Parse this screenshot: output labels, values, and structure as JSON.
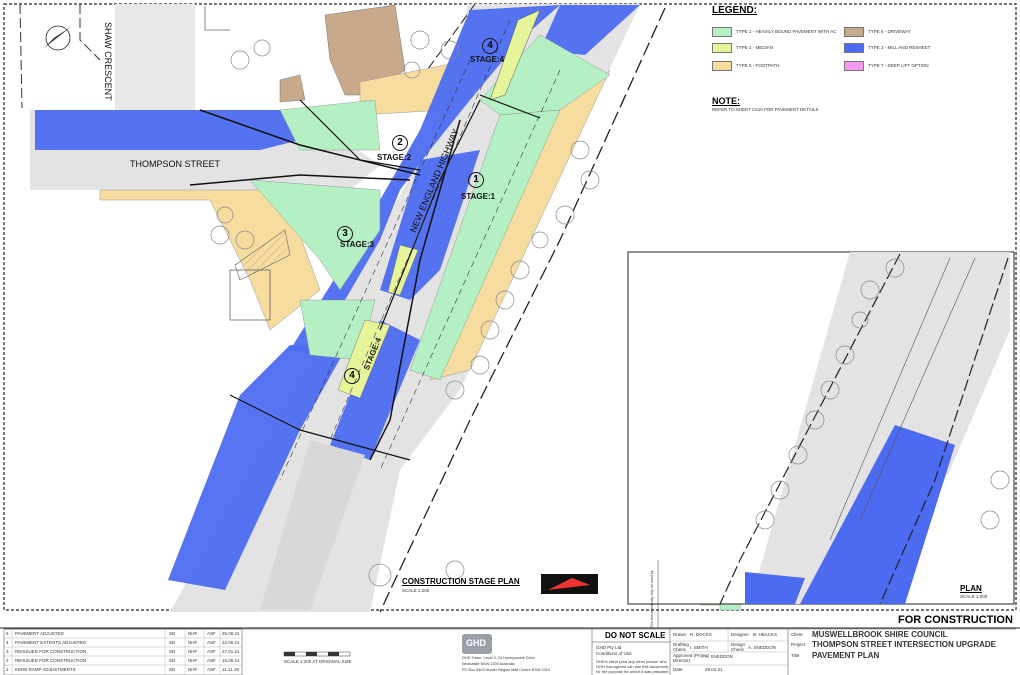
{
  "legend": {
    "title": "LEGEND:",
    "items": [
      {
        "label": "TYPE 1 - HEAVILY BOUND PAVEMENT WITH AC",
        "color": "#b5efc4"
      },
      {
        "label": "TYPE 6 - DRIVEWAY",
        "color": "#c9a98c"
      },
      {
        "label": "TYPE 4 - MEDIAN",
        "color": "#e6f59a"
      },
      {
        "label": "TYPE 2 - MILL AND RESHEET",
        "color": "#4d6bf0"
      },
      {
        "label": "TYPE 5 - FOOTPATH",
        "color": "#f7dca0"
      },
      {
        "label": "TYPE 7 - DEEP LIFT OPTION",
        "color": "#f29af0"
      }
    ]
  },
  "note": {
    "title": "NOTE:",
    "text": "REFER TO SHEET C510 FOR PAVEMENT DETAILS"
  },
  "streets": {
    "shaw_crescent": "SHAW CRESCENT",
    "thompson_street": "THOMPSON STREET",
    "new_england_highway": "NEW ENGLAND HIGHWAY"
  },
  "stages": {
    "stage1": {
      "num": "1",
      "label": "STAGE:1"
    },
    "stage2": {
      "num": "2",
      "label": "STAGE:2"
    },
    "stage3": {
      "num": "3",
      "label": "STAGE:3"
    },
    "stage4a": {
      "num": "4",
      "label": "STAGE:4"
    },
    "stage4b": {
      "num": "4",
      "label": "STAGE:4"
    }
  },
  "plan_titles": {
    "construction_stage_plan": "CONSTRUCTION STAGE PLAN",
    "construction_scale": "SCALE 1:200",
    "plan": "PLAN",
    "plan_scale": "SCALE 1:200"
  },
  "for_construction": "FOR CONSTRUCTION",
  "revisions": [
    {
      "rev": "5",
      "desc": "PAVEMENT ADJUSTED",
      "by": "SD",
      "chk": "NHF",
      "app": "ASF",
      "date": "25.06.21"
    },
    {
      "rev": "4",
      "desc": "PAVEMENT EXTENTS ADJUSTED",
      "by": "SD",
      "chk": "NHF",
      "app": "ASF",
      "date": "22.06.21"
    },
    {
      "rev": "3",
      "desc": "REISSUED FOR CONSTRUCTION",
      "by": "SD",
      "chk": "NHF",
      "app": "ASF",
      "date": "27.01.21"
    },
    {
      "rev": "2",
      "desc": "REISSUED FOR CONSTRUCTION",
      "by": "SD",
      "chk": "NHF",
      "app": "ASF",
      "date": "15.05.21"
    },
    {
      "rev": "1",
      "desc": "KERB RAMP ADJUSTMENTS",
      "by": "SD",
      "chk": "NHF",
      "app": "ASF",
      "date": "11.11.19"
    }
  ],
  "scale_bar": "SCALE 1:200 AT ORIGINAL SIZE",
  "ghd": {
    "logo": "GHD",
    "address1": "GHD Tower, Level 3, 24 Honeysuckle Drive",
    "address2": "Newcastle NSW 2300 Australia",
    "address3": "PO Box 5403 Hunter Region Mail Centre NSW 2310"
  },
  "do_not_scale": "DO NOT SCALE",
  "conditions": {
    "title": "GHD Pty Ltd",
    "subtitle": "Conditions of Use",
    "text1": "GHD's client (and any other person who",
    "text2": "GHD has agreed can use this document)",
    "text3": "for the purpose for which it was prepared"
  },
  "drawn": {
    "label": "Drawn",
    "value": "R. DOCKS"
  },
  "designer": {
    "label": "Designer",
    "value": "B. HBACKS"
  },
  "drafting_check": {
    "label": "Drafting Check",
    "value": "I. SMITH"
  },
  "design_check": {
    "label": "Design Check",
    "value": "A. SNEDDON"
  },
  "approved": {
    "label": "Approved (Project Director)",
    "value": "A. SNEDDON"
  },
  "date": {
    "label": "Date",
    "value": "28.04.21"
  },
  "client": {
    "label": "Client",
    "value": "MUSWELLBROOK SHIRE COUNCIL"
  },
  "project": {
    "label": "Project",
    "value": "THOMPSON STREET INTERSECTION UPGRADE"
  },
  "title": {
    "label": "Title",
    "value": "PAVEMENT PLAN"
  },
  "side_text": "This document may only be used by"
}
